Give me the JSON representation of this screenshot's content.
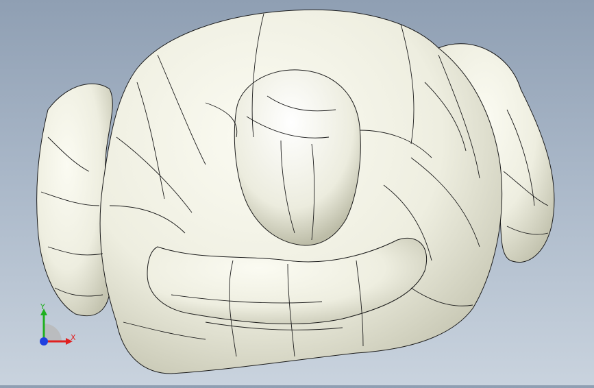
{
  "viewport": {
    "model": "human-figure-mesh",
    "colors": {
      "background_top": "#8f9fb3",
      "background_bottom": "#c9d3de",
      "model_fill": "#f1f1e6",
      "model_shade": "#c8c8b4",
      "edge_lines": "#1a1a1a"
    }
  },
  "triad": {
    "x_label": "X",
    "y_label": "Y",
    "colors": {
      "x": "#e02020",
      "y": "#20b020",
      "z": "#2040e0"
    }
  }
}
